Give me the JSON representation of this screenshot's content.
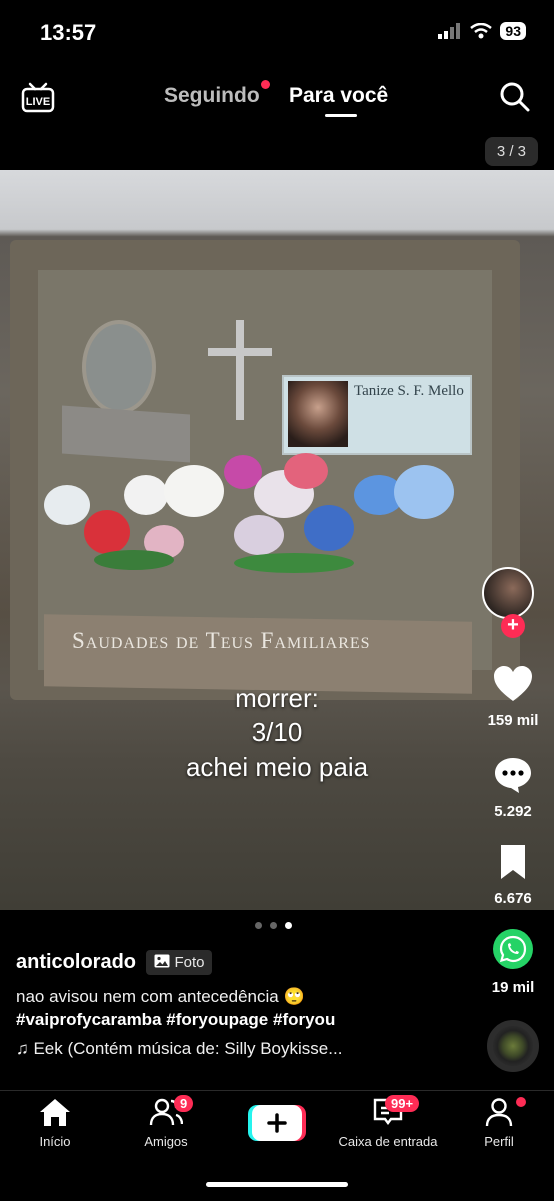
{
  "status_bar": {
    "time": "13:57",
    "battery": "93"
  },
  "top_nav": {
    "tabs": [
      {
        "label": "Seguindo",
        "active": false,
        "has_dot": true
      },
      {
        "label": "Para você",
        "active": true
      }
    ],
    "photo_counter": "3 / 3"
  },
  "photo": {
    "plaque_name": "Tanize S. F. Mello",
    "ledge_text": "Saudades de Teus Familiares"
  },
  "overlay_text": {
    "line1": "morrer:",
    "line2": "3/10",
    "line3": "achei meio paia"
  },
  "actions": {
    "likes": "159 mil",
    "comments": "5.292",
    "saves": "6.676",
    "shares": "19 mil"
  },
  "caption": {
    "author": "anticolorado",
    "photo_tag": "Foto",
    "description": "nao avisou nem com antecedência 🙄",
    "hashtags": "#vaiprofycaramba #foryoupage #foryou",
    "music": "♫ Eek (Contém música de: Silly Boykisse..."
  },
  "carousel": {
    "count": 3,
    "active_index": 2
  },
  "bottom_nav": {
    "items": [
      {
        "label": "Início",
        "icon": "home-icon"
      },
      {
        "label": "Amigos",
        "icon": "friends-icon",
        "badge": "9"
      },
      {
        "label": "",
        "icon": "create-icon"
      },
      {
        "label": "Caixa de entrada",
        "icon": "inbox-icon",
        "badge": "99+"
      },
      {
        "label": "Perfil",
        "icon": "profile-icon",
        "has_dot": true
      }
    ]
  },
  "colors": {
    "accent": "#fe2c55",
    "background": "#000000"
  }
}
